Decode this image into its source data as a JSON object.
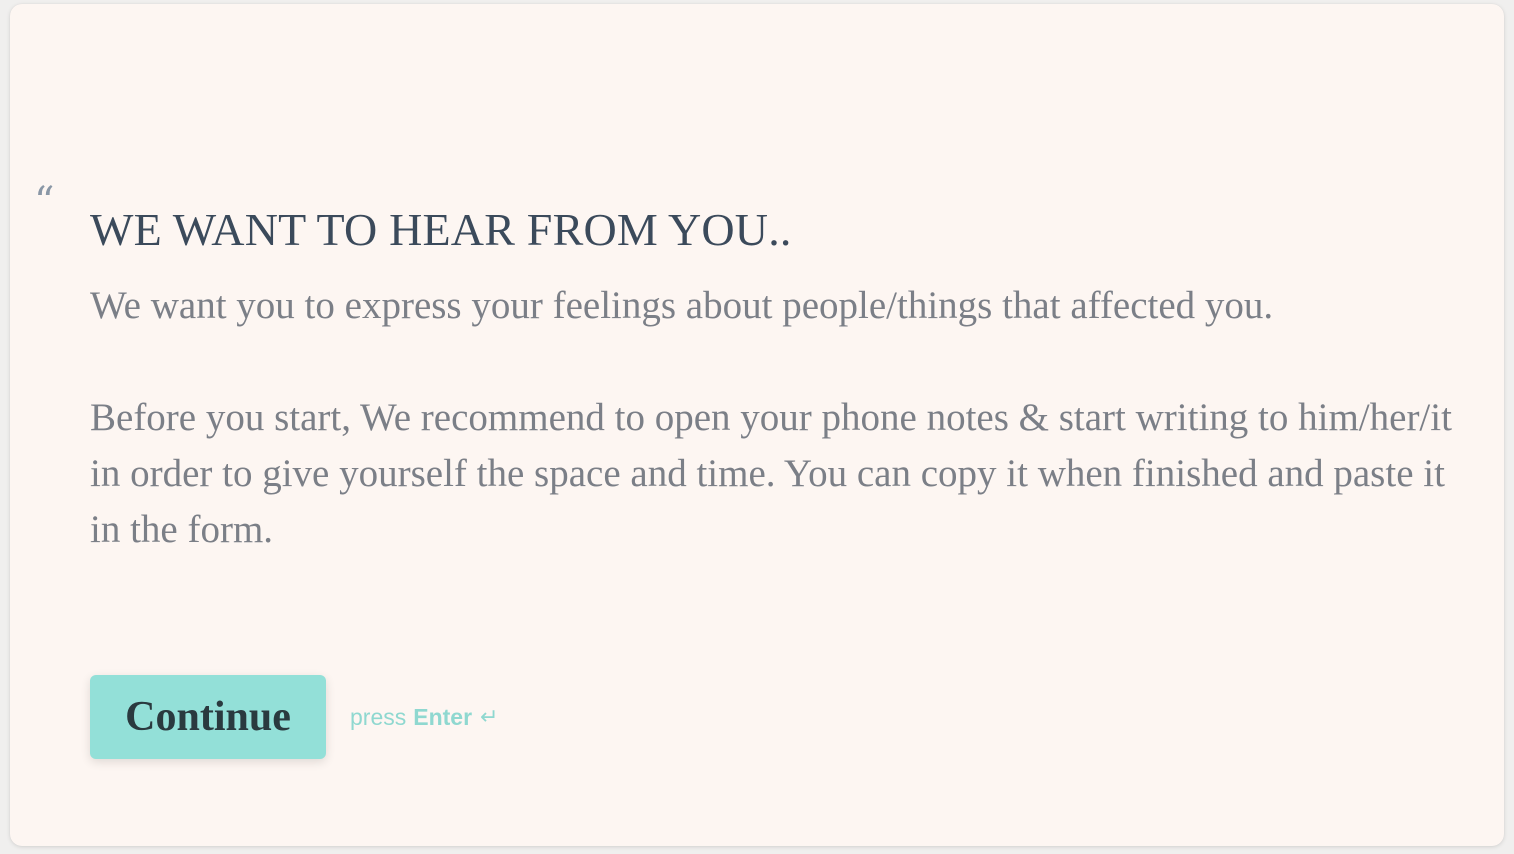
{
  "statement": {
    "quote_glyph": "“",
    "title": "WE WANT TO HEAR FROM YOU..",
    "paragraph_1": "We want you to express your feelings about people/things that affected you.",
    "paragraph_2": "Before you start, We recommend to open your phone notes & start writing to him/her/it in order to give yourself the space and time. You can copy it when finished and paste it in the form."
  },
  "actions": {
    "continue_label": "Continue",
    "hint_prefix": "press",
    "hint_key": "Enter",
    "hint_icon": "↵"
  },
  "colors": {
    "background": "#fdf6f2",
    "button": "#93e0d8",
    "title": "#3b4a5b",
    "body_text": "#7b7f87",
    "hint": "#8fd8d0"
  }
}
